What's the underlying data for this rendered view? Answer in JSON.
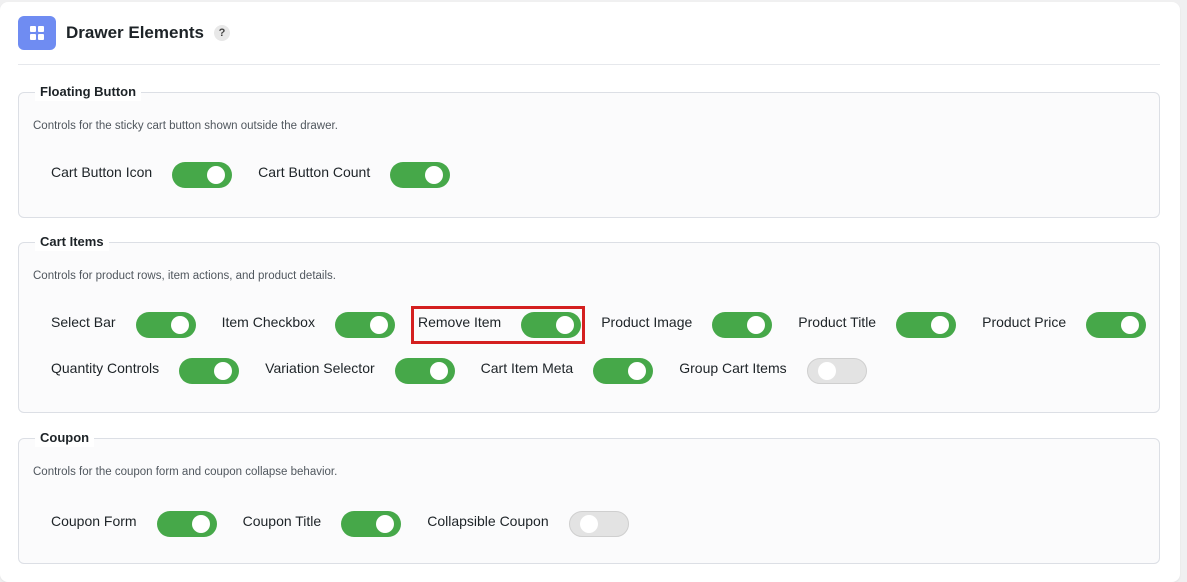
{
  "header": {
    "title": "Drawer Elements",
    "help": "?"
  },
  "groups": [
    {
      "title": "Floating Button",
      "description": "Controls for the sticky cart button shown outside the drawer.",
      "rows": [
        [
          {
            "label": "Cart Button Icon",
            "enabled": true
          },
          {
            "label": "Cart Button Count",
            "enabled": true
          }
        ]
      ]
    },
    {
      "title": "Cart Items",
      "description": "Controls for product rows, item actions, and product details.",
      "rows": [
        [
          {
            "label": "Select Bar",
            "enabled": true
          },
          {
            "label": "Item Checkbox",
            "enabled": true
          },
          {
            "label": "Remove Item",
            "enabled": true,
            "highlighted": true
          },
          {
            "label": "Product Image",
            "enabled": true
          },
          {
            "label": "Product Title",
            "enabled": true
          },
          {
            "label": "Product Price",
            "enabled": true
          }
        ],
        [
          {
            "label": "Quantity Controls",
            "enabled": true
          },
          {
            "label": "Variation Selector",
            "enabled": true
          },
          {
            "label": "Cart Item Meta",
            "enabled": true
          },
          {
            "label": "Group Cart Items",
            "enabled": false
          }
        ]
      ]
    },
    {
      "title": "Coupon",
      "description": "Controls for the coupon form and coupon collapse behavior.",
      "rows": [
        [
          {
            "label": "Coupon Form",
            "enabled": true
          },
          {
            "label": "Coupon Title",
            "enabled": true
          },
          {
            "label": "Collapsible Coupon",
            "enabled": false
          }
        ]
      ]
    }
  ],
  "colors": {
    "toggle_on": "#46a849",
    "toggle_off": "#e3e3e3",
    "header_icon_bg": "#6f8cf2",
    "highlight_border": "#d41f1f"
  },
  "icons": {
    "header": "grid-icon",
    "help": "help-icon"
  }
}
